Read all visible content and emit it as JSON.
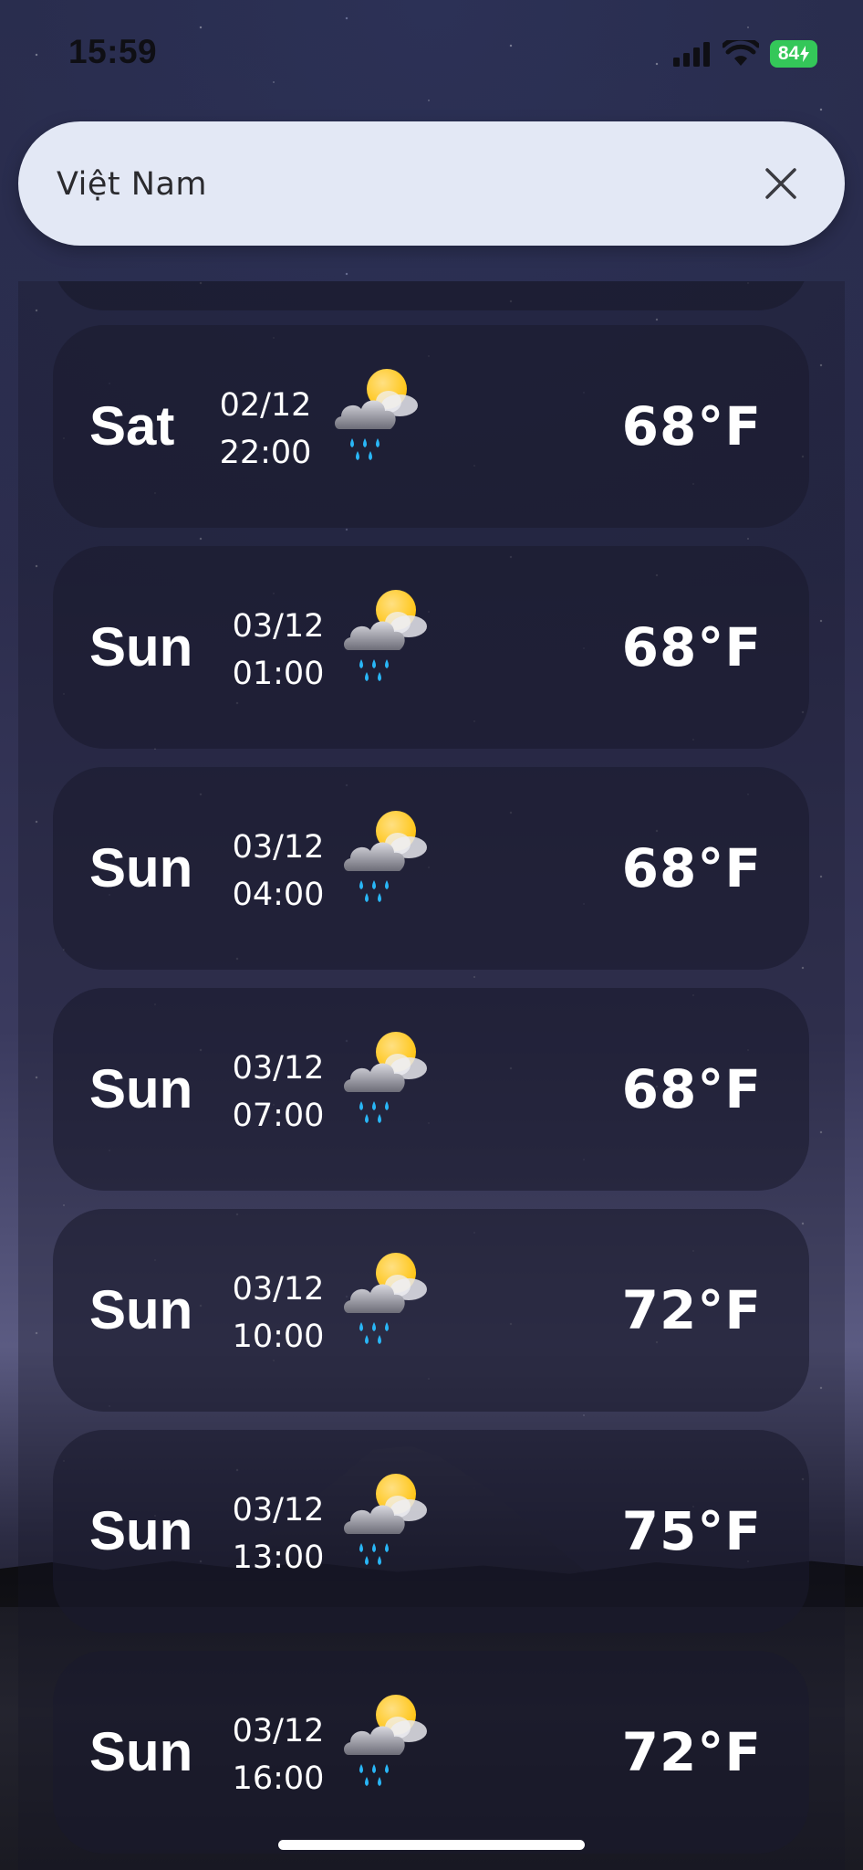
{
  "status_bar": {
    "time": "15:59",
    "battery": "84"
  },
  "search": {
    "value": "Việt Nam"
  },
  "forecast": [
    {
      "day": "Sat",
      "date": "02/12",
      "time": "22:00",
      "temp": "68°F",
      "icon": "rain-sun-cloud-icon"
    },
    {
      "day": "Sun",
      "date": "03/12",
      "time": "01:00",
      "temp": "68°F",
      "icon": "rain-sun-cloud-icon"
    },
    {
      "day": "Sun",
      "date": "03/12",
      "time": "04:00",
      "temp": "68°F",
      "icon": "rain-sun-cloud-icon"
    },
    {
      "day": "Sun",
      "date": "03/12",
      "time": "07:00",
      "temp": "68°F",
      "icon": "rain-sun-cloud-icon"
    },
    {
      "day": "Sun",
      "date": "03/12",
      "time": "10:00",
      "temp": "72°F",
      "icon": "rain-sun-cloud-icon"
    },
    {
      "day": "Sun",
      "date": "03/12",
      "time": "13:00",
      "temp": "75°F",
      "icon": "rain-sun-cloud-icon"
    },
    {
      "day": "Sun",
      "date": "03/12",
      "time": "16:00",
      "temp": "72°F",
      "icon": "rain-sun-cloud-icon"
    }
  ],
  "colors": {
    "search_bg": "#e3e8f5",
    "battery": "#34c759",
    "rain_drop": "#29b6f6",
    "sun": "#ffc107"
  }
}
